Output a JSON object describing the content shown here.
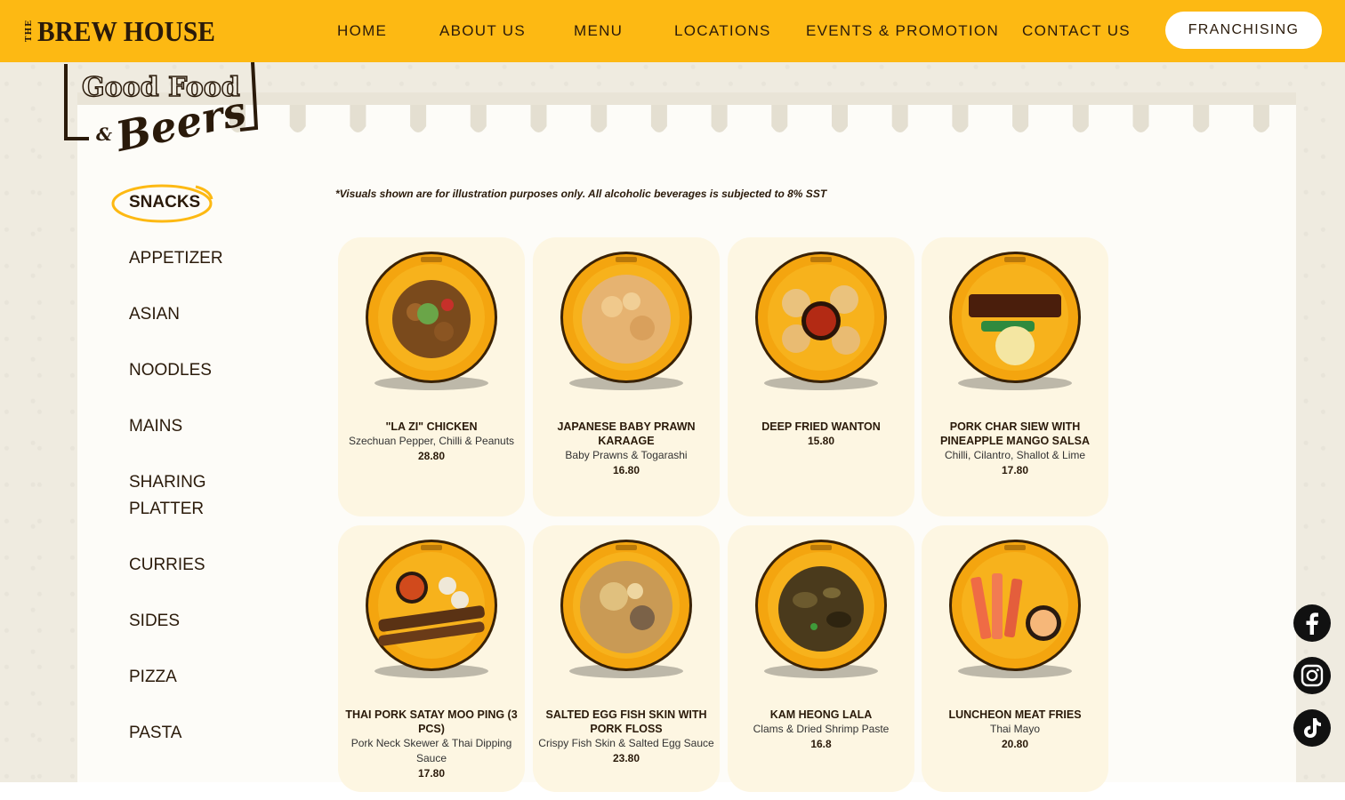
{
  "brand": {
    "logo_small": "THE",
    "logo_main": "BREW HOUSE"
  },
  "nav": {
    "home": "HOME",
    "about": "ABOUT US",
    "menu": "MENU",
    "locations": "LOCATIONS",
    "events": "EVENTS & PROMOTION",
    "contact": "CONTACT US",
    "franchising": "FRANCHISING"
  },
  "stamp": {
    "line1": "Good Food",
    "line2": "Beers",
    "amp": "&"
  },
  "sidebar": {
    "items": [
      {
        "label": "SNACKS",
        "active": true
      },
      {
        "label": "APPETIZER"
      },
      {
        "label": "ASIAN"
      },
      {
        "label": "NOODLES"
      },
      {
        "label": "MAINS"
      },
      {
        "label": "SHARING"
      },
      {
        "label": "PLATTER"
      },
      {
        "label": "CURRIES"
      },
      {
        "label": "SIDES"
      },
      {
        "label": "PIZZA"
      },
      {
        "label": "PASTA"
      }
    ]
  },
  "disclaimer": "*Visuals shown are for illustration purposes only. All alcoholic beverages is subjected to 8% SST",
  "dishes": [
    {
      "name": "\"LA ZI\" CHICKEN",
      "desc": "Szechuan Pepper, Chilli & Peanuts",
      "price": "28.80"
    },
    {
      "name": "JAPANESE BABY PRAWN KARAAGE",
      "desc": "Baby Prawns & Togarashi",
      "price": "16.80"
    },
    {
      "name": "DEEP FRIED WANTON",
      "desc": "",
      "price": "15.80"
    },
    {
      "name": "PORK CHAR SIEW WITH PINEAPPLE MANGO SALSA",
      "desc": "Chilli, Cilantro, Shallot & Lime",
      "price": "17.80"
    },
    {
      "name": "THAI PORK SATAY MOO PING (3 PCS)",
      "desc": "Pork Neck Skewer & Thai Dipping Sauce",
      "price": "17.80"
    },
    {
      "name": "SALTED EGG FISH SKIN WITH PORK FLOSS",
      "desc": "Crispy Fish Skin & Salted Egg Sauce",
      "price": "23.80"
    },
    {
      "name": "KAM HEONG LALA",
      "desc": "Clams & Dried Shrimp Paste",
      "price": "16.8"
    },
    {
      "name": "LUNCHEON MEAT FRIES",
      "desc": "Thai Mayo",
      "price": "20.80"
    }
  ],
  "colors": {
    "brand_yellow": "#fdb913",
    "dark": "#2a1a0a",
    "card_bg": "#fdf6e2"
  },
  "social": [
    "facebook-icon",
    "instagram-icon",
    "tiktok-icon"
  ]
}
